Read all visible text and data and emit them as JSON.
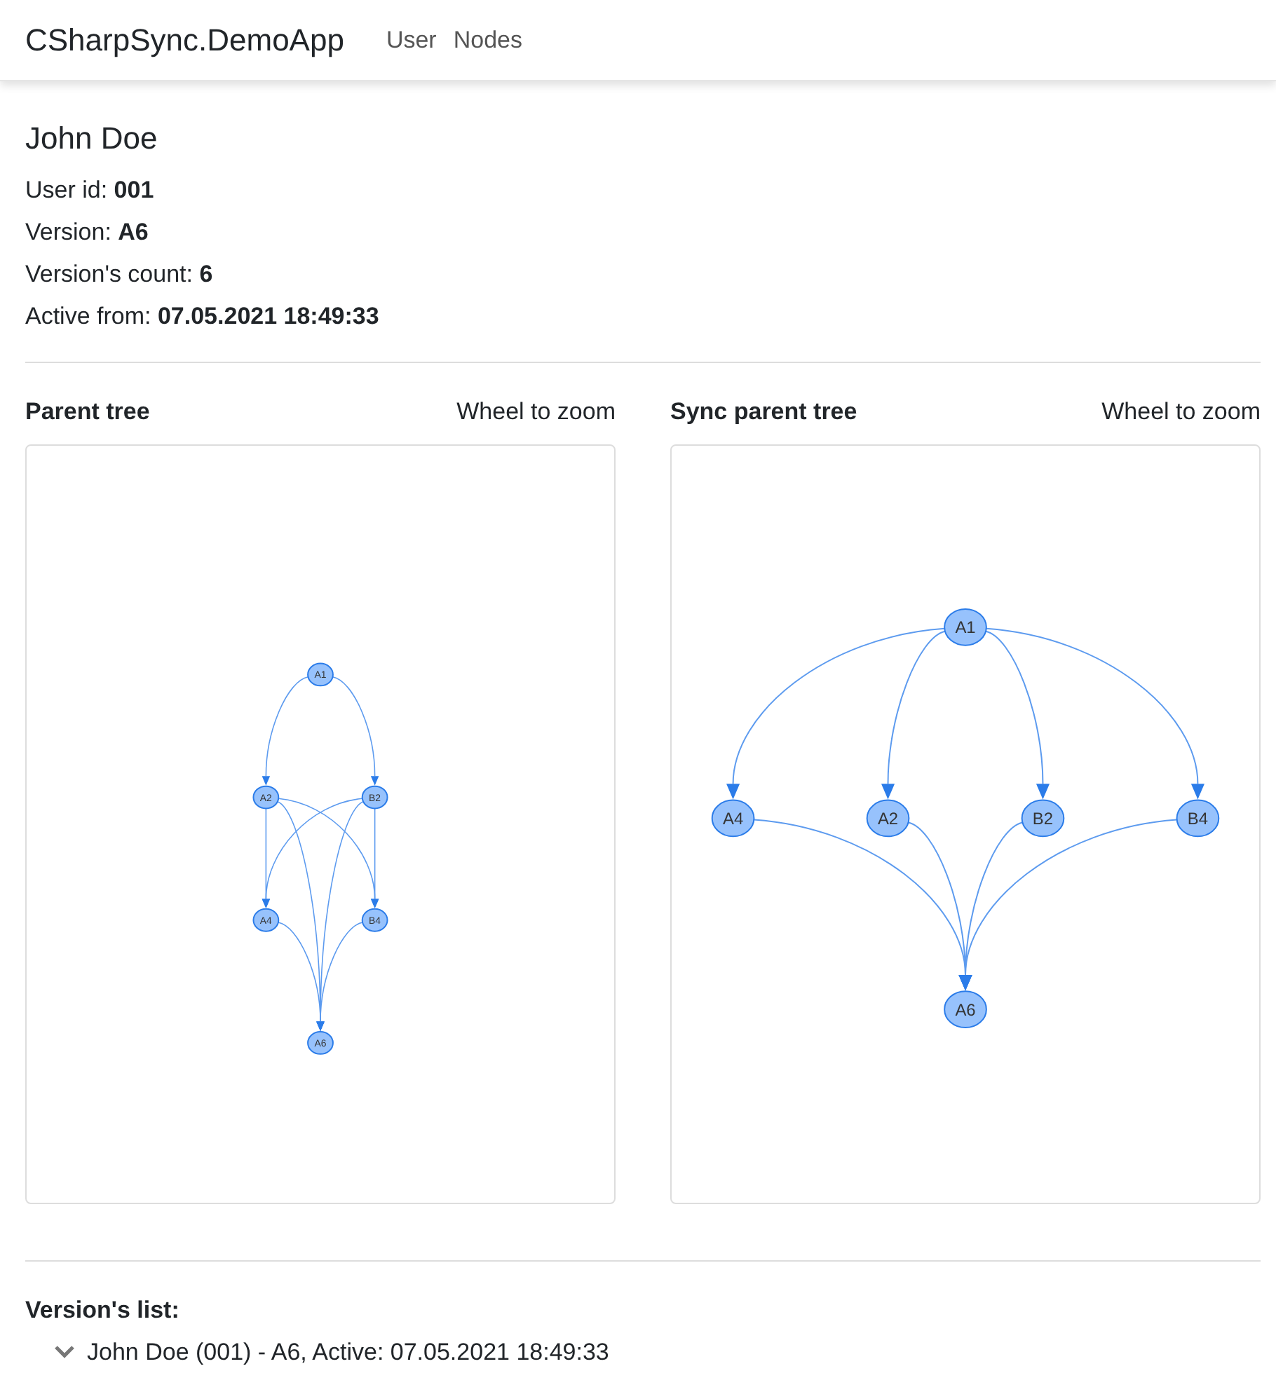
{
  "navbar": {
    "brand": "CSharpSync.DemoApp",
    "links": [
      "User",
      "Nodes"
    ]
  },
  "user": {
    "name": "John Doe",
    "fields": [
      {
        "label": "User id:",
        "value": "001"
      },
      {
        "label": "Version:",
        "value": "A6"
      },
      {
        "label": "Version's count:",
        "value": "6"
      },
      {
        "label": "Active from:",
        "value": "07.05.2021 18:49:33"
      }
    ]
  },
  "graphs": [
    {
      "title": "Parent tree",
      "hint": "Wheel to zoom",
      "nodes": [
        {
          "label": "A1",
          "links_to": [
            false,
            true,
            true,
            false,
            false,
            false
          ]
        },
        {
          "label": "A2",
          "links_to": [
            false,
            false,
            false,
            true,
            true,
            true
          ]
        },
        {
          "label": "B2",
          "links_to": [
            false,
            false,
            false,
            true,
            true,
            true
          ]
        },
        {
          "label": "A4",
          "links_to": [
            false,
            false,
            false,
            false,
            false,
            true
          ]
        },
        {
          "label": "B4",
          "links_to": [
            false,
            false,
            false,
            false,
            false,
            true
          ]
        },
        {
          "label": "A6",
          "links_to": [
            false,
            false,
            false,
            false,
            false,
            false
          ]
        }
      ]
    },
    {
      "title": "Sync parent tree",
      "hint": "Wheel to zoom",
      "nodes": [
        {
          "label": "A1",
          "links_to": [
            false,
            true,
            true,
            true,
            true,
            false
          ]
        },
        {
          "label": "A4",
          "links_to": [
            false,
            false,
            false,
            false,
            false,
            true
          ]
        },
        {
          "label": "A2",
          "links_to": [
            false,
            false,
            false,
            false,
            false,
            true
          ]
        },
        {
          "label": "B2",
          "links_to": [
            false,
            false,
            false,
            false,
            false,
            true
          ]
        },
        {
          "label": "B4",
          "links_to": [
            false,
            false,
            false,
            false,
            false,
            true
          ]
        },
        {
          "label": "A6",
          "links_to": [
            false,
            false,
            false,
            false,
            false,
            false
          ]
        }
      ]
    }
  ],
  "versions": {
    "title": "Version's list:",
    "items": [
      {
        "text": "John Doe (001) - A6, Active: 07.05.2021 18:49:33",
        "expanded": true
      }
    ]
  }
}
